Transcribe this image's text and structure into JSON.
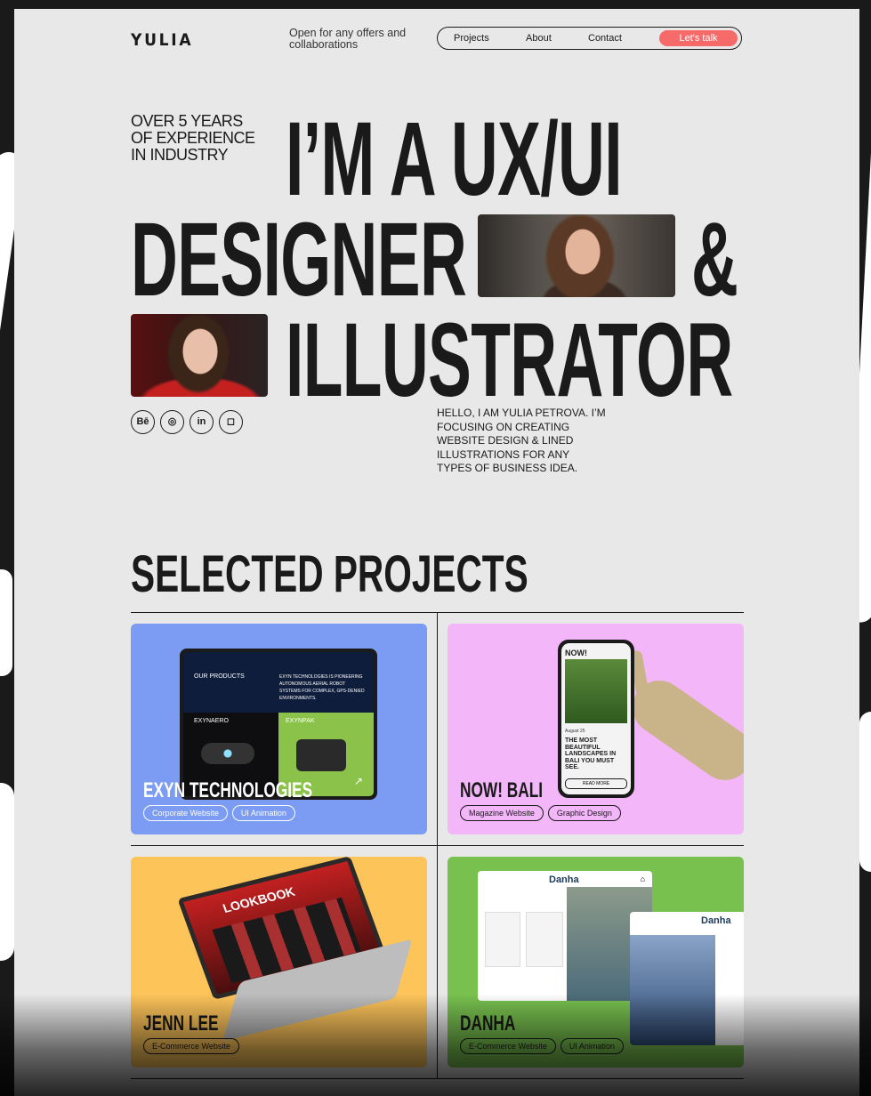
{
  "header": {
    "logo": "YULIA",
    "tagline": "Open for any offers and collaborations",
    "nav": [
      "Projects",
      "About",
      "Contact"
    ],
    "cta": "Let's talk"
  },
  "hero": {
    "experience": "OVER 5 YEARS OF EXPERIENCE IN INDUSTRY",
    "line1": "I’M A UX/UI",
    "line2a": "DESIGNER",
    "line2b": "&",
    "line3": "ILLUSTRATOR",
    "bio": "HELLO, I AM YULIA PETROVA. I’M FOCUSING ON CREATING WEBSITE DESIGN & LINED ILLUSTRATIONS FOR ANY TYPES OF BUSINESS IDEA."
  },
  "socials": [
    {
      "label": "Bē",
      "icon": "behance-icon"
    },
    {
      "label": "◎",
      "icon": "dribbble-icon"
    },
    {
      "label": "in",
      "icon": "linkedin-icon"
    },
    {
      "label": "◻",
      "icon": "instagram-icon"
    }
  ],
  "projects": {
    "title": "SELECTED PROJECTS",
    "items": [
      {
        "name": "EXYN TECHNOLOGIES",
        "tags": [
          "Corporate Website",
          "UI Animation"
        ],
        "color": "#7b9cf2",
        "mock": {
          "products": "OUR PRODUCTS",
          "desc": "EXYN TECHNOLOGIES IS PIONEERING AUTONOMOUS AERIAL ROBOT SYSTEMS FOR COMPLEX, GPS-DENIED ENVIRONMENTS.",
          "p1": "EXYNAERO",
          "p2": "EXYNPAK"
        }
      },
      {
        "name": "NOW! BALI",
        "tags": [
          "Magazine Website",
          "Graphic Design"
        ],
        "color": "#f2b6f9",
        "mock": {
          "logo": "NOW!",
          "date": "August 25",
          "headline": "THE MOST BEAUTIFUL LANDSCAPES IN BALI YOU MUST SEE.",
          "button": "READ MORE"
        }
      },
      {
        "name": "JENN LEE",
        "tags": [
          "E-Commerce Website"
        ],
        "color": "#fdc45a",
        "mock": {
          "label": "LOOKBOOK"
        }
      },
      {
        "name": "DANHA",
        "tags": [
          "E-Commerce Website",
          "UI Animation"
        ],
        "color": "#78c14f",
        "mock": {
          "brand": "Danha"
        }
      }
    ]
  }
}
